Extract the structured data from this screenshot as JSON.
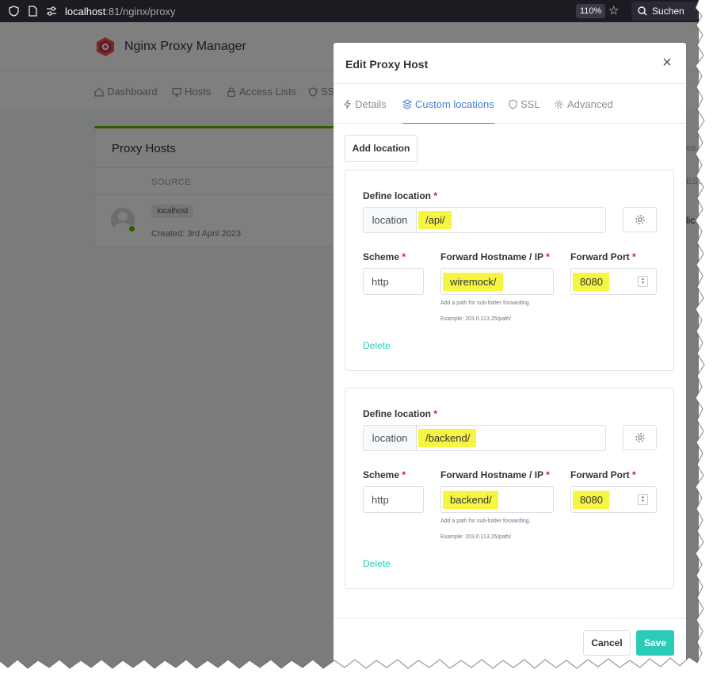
{
  "browser": {
    "url_host": "localhost",
    "url_rest": ":81/nginx/proxy",
    "zoom": "110%",
    "search_label": "Suchen"
  },
  "app": {
    "brand": "Nginx Proxy Manager",
    "nav": [
      {
        "label": "Dashboard",
        "icon": "home-icon"
      },
      {
        "label": "Hosts",
        "icon": "monitor-icon"
      },
      {
        "label": "Access Lists",
        "icon": "lock-icon"
      },
      {
        "label": "SSL",
        "icon": "shield-icon"
      }
    ],
    "card_title": "Proxy Hosts",
    "col_source": "SOURCE",
    "row": {
      "source": "localhost",
      "created": "Created: 3rd April 2023"
    },
    "right_stubs": [
      "ESS",
      "ea",
      "lic"
    ]
  },
  "modal": {
    "title": "Edit Proxy Host",
    "tabs": [
      {
        "label": "Details",
        "icon": "bolt-icon",
        "active": false
      },
      {
        "label": "Custom locations",
        "icon": "layers-icon",
        "active": true
      },
      {
        "label": "SSL",
        "icon": "shield-icon",
        "active": false
      },
      {
        "label": "Advanced",
        "icon": "gear-icon",
        "active": false
      }
    ],
    "add_location": "Add location",
    "locations": [
      {
        "define_label": "Define location",
        "addon": "location",
        "path": "/api/",
        "scheme_label": "Scheme",
        "scheme": "http",
        "host_label": "Forward Hostname / IP",
        "host": "wiremock/",
        "port_label": "Forward Port",
        "port": "8080",
        "help1": "Add a path for sub-folder forwarding.",
        "help2": "Example: 203.0.113.25/path/",
        "delete": "Delete"
      },
      {
        "define_label": "Define location",
        "addon": "location",
        "path": "/backend/",
        "scheme_label": "Scheme",
        "scheme": "http",
        "host_label": "Forward Hostname / IP",
        "host": "backend/",
        "port_label": "Forward Port",
        "port": "8080",
        "help1": "Add a path for sub-folder forwarding.",
        "help2": "Example: 203.0.113.25/path/",
        "delete": "Delete"
      }
    ],
    "required_mark": "*",
    "cancel": "Cancel",
    "save": "Save"
  },
  "colors": {
    "accent_blue": "#467fcf",
    "teal": "#2bcbba",
    "highlight": "#f5f542",
    "required": "#cd201f",
    "green": "#5eba00"
  }
}
